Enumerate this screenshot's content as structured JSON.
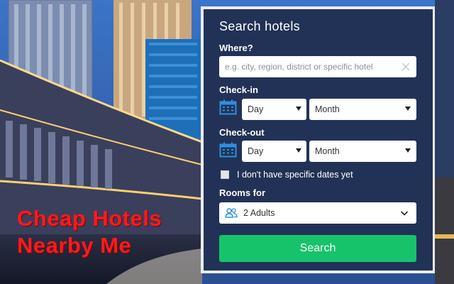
{
  "background": {
    "headline_lines": [
      "Cheap Hotels",
      "Nearby Me"
    ],
    "headline_color": "#ff1a1a"
  },
  "search_panel": {
    "title": "Search hotels",
    "where": {
      "label": "Where?",
      "placeholder": "e.g. city, region, district or specific hotel",
      "clear_icon": "close-icon"
    },
    "checkin": {
      "label": "Check-in",
      "icon": "calendar-icon",
      "day": "Day",
      "month": "Month"
    },
    "checkout": {
      "label": "Check-out",
      "icon": "calendar-icon",
      "day": "Day",
      "month": "Month"
    },
    "no_dates": {
      "label": "I don't have specific dates yet",
      "checked": false
    },
    "rooms": {
      "label": "Rooms for",
      "value": "2 Adults",
      "icon": "people-icon"
    },
    "search_button": "Search"
  },
  "colors": {
    "panel": "#223256",
    "accent_green": "#17c36a",
    "icon_blue": "#2f8fe0"
  }
}
